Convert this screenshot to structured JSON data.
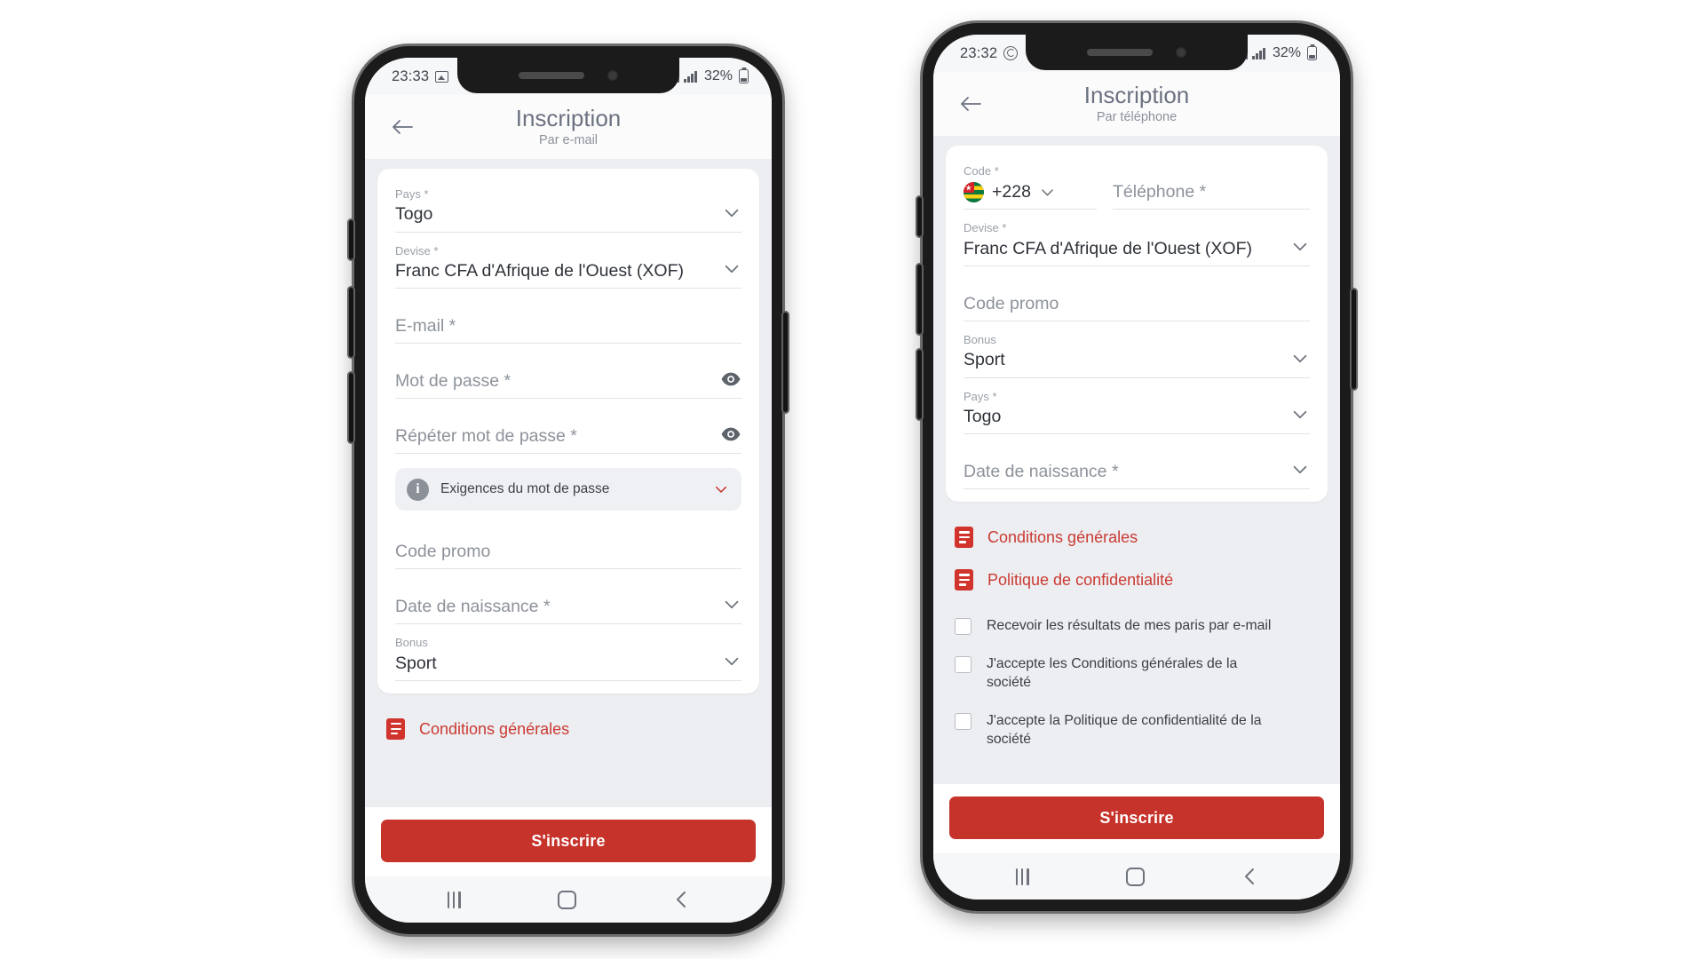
{
  "theme": {
    "accent_red": "#c6332b",
    "link_red": "#cc3a33",
    "screen_bg": "#eceef1"
  },
  "phone_email": {
    "status_bar": {
      "time": "23:33",
      "notification_icon": "gallery-icon",
      "battery_percent": "32%"
    },
    "header": {
      "title": "Inscription",
      "subtitle": "Par e-mail",
      "back_icon": "back-arrow-icon"
    },
    "fields": [
      {
        "label": "Pays *",
        "value": "Togo",
        "control": "dropdown"
      },
      {
        "label": "Devise *",
        "value": "Franc CFA d'Afrique de l'Ouest (XOF)",
        "control": "dropdown"
      },
      {
        "placeholder": "E-mail *",
        "control": "text"
      },
      {
        "placeholder": "Mot de passe *",
        "control": "password"
      },
      {
        "placeholder": "Répéter mot de passe *",
        "control": "password"
      },
      {
        "placeholder": "Code promo",
        "control": "text"
      },
      {
        "placeholder": "Date de naissance *",
        "control": "dropdown"
      },
      {
        "label": "Bonus",
        "value": "Sport",
        "control": "dropdown"
      }
    ],
    "password_requirements": {
      "text": "Exigences du mot de passe",
      "info_glyph": "i"
    },
    "links": [
      {
        "text": "Conditions générales",
        "icon": "document-icon"
      }
    ],
    "submit_label": "S'inscrire"
  },
  "phone_tel": {
    "status_bar": {
      "time": "23:32",
      "notification_icon": "whatsapp-icon",
      "battery_percent": "32%"
    },
    "header": {
      "title": "Inscription",
      "subtitle": "Par téléphone",
      "back_icon": "back-arrow-icon"
    },
    "code_field": {
      "label": "Code *",
      "value": "+228",
      "flag": "togo-flag-icon"
    },
    "phone_field": {
      "placeholder": "Téléphone *"
    },
    "fields": [
      {
        "label": "Devise *",
        "value": "Franc CFA d'Afrique de l'Ouest (XOF)",
        "control": "dropdown"
      },
      {
        "placeholder": "Code promo",
        "control": "text"
      },
      {
        "label": "Bonus",
        "value": "Sport",
        "control": "dropdown"
      },
      {
        "label": "Pays *",
        "value": "Togo",
        "control": "dropdown"
      },
      {
        "placeholder": "Date de naissance *",
        "control": "dropdown"
      }
    ],
    "links": [
      {
        "text": "Conditions générales",
        "icon": "document-icon"
      },
      {
        "text": "Politique de confidentialité",
        "icon": "document-icon"
      }
    ],
    "checkboxes": [
      {
        "text": "Recevoir les résultats de mes paris par e-mail",
        "checked": false
      },
      {
        "text": "J'accepte les Conditions générales de la société",
        "checked": false
      },
      {
        "text": "J'accepte la Politique de confidentialité de la société",
        "checked": false
      }
    ],
    "submit_label": "S'inscrire"
  },
  "nav_bar": {
    "recent_icon": "recent-apps-icon",
    "home_icon": "home-icon",
    "back_icon": "back-nav-icon"
  }
}
